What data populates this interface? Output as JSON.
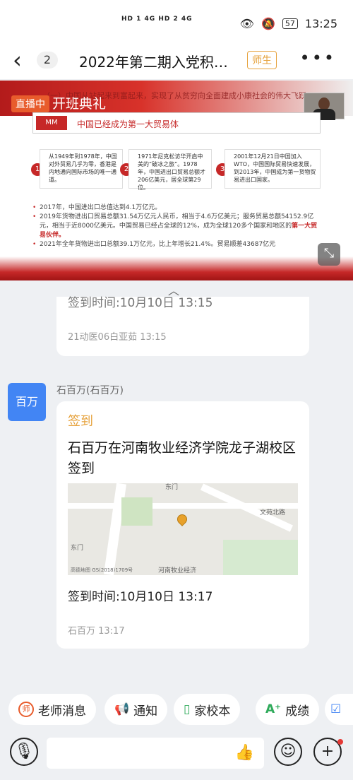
{
  "status_bar": {
    "signal_left": "HD 1 4G  HD 2 4G",
    "time": "13:25",
    "battery": "57"
  },
  "nav": {
    "back_count": "2",
    "title": "2022年第二期入党积…",
    "role_badge": "师生",
    "more": "•••"
  },
  "live": {
    "tag": "直播中",
    "title": "开班典礼",
    "slide_heading": "（一）中国从站起来到富起来，实现了从贫穷向全面建成小康社会的伟大飞跃",
    "section_icon": "MM",
    "section_title": "中国已经成为第一大贸易体",
    "cards": [
      {
        "num": "1",
        "text": "从1949年到1978年，中国对外贸易几乎为零，香港是内地通向国际市场的唯一通道。"
      },
      {
        "num": "2",
        "text": "1971年尼克松访华开启中美的“破冰之旅”。1978年，中国进出口贸易总额才206亿美元，居全球第29位。"
      },
      {
        "num": "3",
        "text": "2001年12月21日中国加入WTO，中国国际贸易快速发展，到2013年，中国成为第一货物贸易进出口国家。"
      }
    ],
    "bullets": [
      "2017年，中国进出口总值达到4.1万亿元。",
      "2019年货物进出口贸易总额31.54万亿元人民币，相当于4.6万亿美元；服务贸易总额54152.9亿元，相当于近8000亿美元。中国贸易已经占全球的12%，成为全球120多个国家和地区的",
      "2021年全年货物进出口总额39.1万亿元，比上年增长21.4%。贸易顺差43687亿元"
    ],
    "bullet_highlight": "第一大贸易伙伴。"
  },
  "prev_message": {
    "sign_time": "签到时间:10月10日 13:15",
    "footer": "21动医06白亚茹 13:15"
  },
  "message": {
    "avatar_text": "百万",
    "sender": "石百万(石百万)",
    "tag": "签到",
    "title": "石百万在河南牧业经济学院龙子湖校区签到",
    "map_labels": {
      "road1": "东门",
      "road2": "文苑北路",
      "road3": "东门",
      "poi": "河南牧业经济",
      "copyright": "高德地图 GS(2018)1709号"
    },
    "sign_time": "签到时间:10月10日 13:17",
    "footer": "石百万 13:17"
  },
  "shortcuts": [
    {
      "label": "老师消息",
      "icon": "teacher-icon"
    },
    {
      "label": "通知",
      "icon": "megaphone-icon"
    },
    {
      "label": "家校本",
      "icon": "notebook-icon"
    },
    {
      "label": "成绩",
      "icon": "grade-icon"
    }
  ],
  "colors": {
    "accent": "#e6a23c",
    "brand_red": "#c62828",
    "avatar_blue": "#4285f4"
  }
}
